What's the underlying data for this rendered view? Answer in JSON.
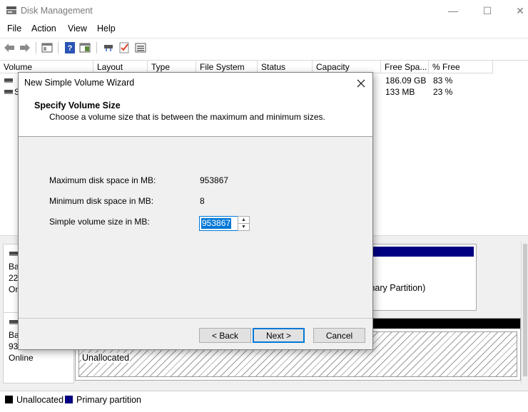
{
  "window": {
    "title": "Disk Management",
    "minimize_glyph": "—",
    "maximize_glyph": "☐",
    "close_glyph": "✕"
  },
  "menu": [
    "File",
    "Action",
    "View",
    "Help"
  ],
  "toolbar_icons": [
    "back-arrow-icon",
    "forward-arrow-icon",
    "console-tree-icon",
    "help-icon",
    "show-hide-pane-icon",
    "connect-drive-icon",
    "properties-check-icon",
    "list-view-icon"
  ],
  "volume_list": {
    "columns": [
      "Volume",
      "Layout",
      "Type",
      "File System",
      "Status",
      "Capacity",
      "Free Spa...",
      "% Free"
    ],
    "rows": [
      {
        "volume": "",
        "free": "186.09 GB",
        "pct": "83 %"
      },
      {
        "volume": "S",
        "free": "133 MB",
        "pct": "23 %"
      }
    ]
  },
  "disks": [
    {
      "line1": "Bas",
      "line2": "223",
      "line3": "Onl"
    },
    {
      "line1": "Bas",
      "line2": "931",
      "line3": "Online"
    }
  ],
  "partitions": {
    "primary_text": "mary Partition)",
    "unallocated_text": "Unallocated"
  },
  "legend": {
    "unallocated": "Unallocated",
    "primary": "Primary partition",
    "unallocated_color": "#000000",
    "primary_color": "#000080"
  },
  "wizard": {
    "title": "New Simple Volume Wizard",
    "heading": "Specify Volume Size",
    "subheading": "Choose a volume size that is between the maximum and minimum sizes.",
    "max_label": "Maximum disk space in MB:",
    "max_value": "953867",
    "min_label": "Minimum disk space in MB:",
    "min_value": "8",
    "size_label": "Simple volume size in MB:",
    "size_value": "953867",
    "back_label": "< Back",
    "next_label": "Next >",
    "cancel_label": "Cancel"
  }
}
